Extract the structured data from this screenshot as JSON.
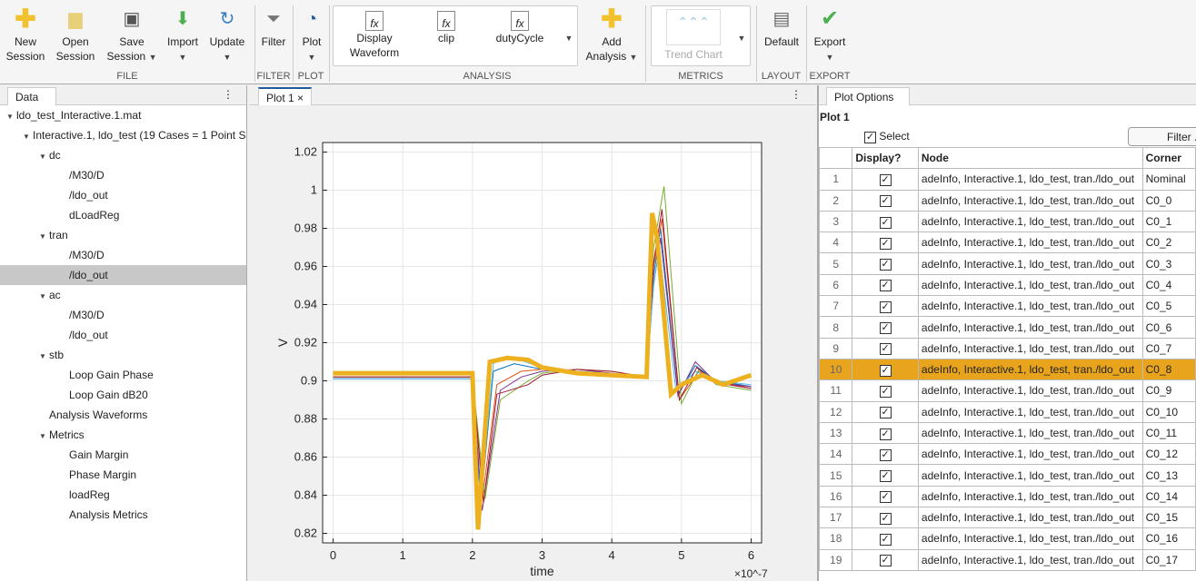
{
  "toolstrip": {
    "buttons": {
      "new_session": "New\nSession",
      "open_session": "Open\nSession",
      "save_session": "Save\nSession",
      "import": "Import",
      "update": "Update",
      "filter": "Filter",
      "plot": "Plot",
      "display_waveform": "Display\nWaveform",
      "clip": "clip",
      "duty_cycle": "dutyCycle",
      "add_analysis": "Add\nAnalysis",
      "trend_chart": "Trend Chart",
      "default": "Default",
      "export": "Export"
    },
    "sections": {
      "file": "FILE",
      "filter": "FILTER",
      "plot": "PLOT",
      "analysis": "ANALYSIS",
      "metrics": "METRICS",
      "layout": "LAYOUT",
      "export": "EXPORT"
    }
  },
  "data_panel": {
    "tab": "Data",
    "tree": [
      {
        "label": "ldo_test_Interactive.1.mat",
        "level": 0,
        "twisty": true
      },
      {
        "label": "Interactive.1, ldo_test  (19 Cases = 1 Point S",
        "level": 1,
        "twisty": true
      },
      {
        "label": "dc",
        "level": 2,
        "twisty": true
      },
      {
        "label": "/M30/D",
        "level": 3
      },
      {
        "label": "/ldo_out",
        "level": 3
      },
      {
        "label": "dLoadReg",
        "level": 3
      },
      {
        "label": "tran",
        "level": 2,
        "twisty": true
      },
      {
        "label": "/M30/D",
        "level": 3
      },
      {
        "label": "/ldo_out",
        "level": 3,
        "selected": true
      },
      {
        "label": "ac",
        "level": 2,
        "twisty": true
      },
      {
        "label": "/M30/D",
        "level": 3
      },
      {
        "label": "/ldo_out",
        "level": 3
      },
      {
        "label": "stb",
        "level": 2,
        "twisty": true
      },
      {
        "label": "Loop Gain Phase",
        "level": 3
      },
      {
        "label": "Loop Gain dB20",
        "level": 3
      },
      {
        "label": "Analysis Waveforms",
        "level": 2
      },
      {
        "label": "Metrics",
        "level": 2,
        "twisty": true
      },
      {
        "label": "Gain Margin",
        "level": 3
      },
      {
        "label": "Phase Margin",
        "level": 3
      },
      {
        "label": "loadReg",
        "level": 3
      },
      {
        "label": "Analysis Metrics",
        "level": 3
      }
    ]
  },
  "plot_panel": {
    "tab": "Plot 1"
  },
  "chart_data": {
    "type": "line",
    "xlabel": "time",
    "ylabel": "V",
    "x_exponent": "×10^-7",
    "xlim": [
      -0.15,
      6.15
    ],
    "ylim": [
      0.815,
      1.025
    ],
    "xticks": [
      0,
      1,
      2,
      3,
      4,
      5,
      6
    ],
    "yticks": [
      0.82,
      0.84,
      0.86,
      0.88,
      0.9,
      0.92,
      0.94,
      0.96,
      0.98,
      1,
      1.02
    ],
    "ytick_labels": [
      "0.82",
      "0.84",
      "0.86",
      "0.88",
      "0.9",
      "0.92",
      "0.94",
      "0.96",
      "0.98",
      "1",
      "1.02"
    ],
    "grid": true,
    "series": [
      {
        "name": "C0_0",
        "color": "#0072bd",
        "x": [
          0,
          2,
          2.12,
          2.3,
          2.6,
          3,
          3.5,
          4,
          4.5,
          4.6,
          4.7,
          4.95,
          5.2,
          5.5,
          6
        ],
        "y": [
          0.901,
          0.901,
          0.835,
          0.905,
          0.909,
          0.906,
          0.905,
          0.904,
          0.902,
          0.955,
          0.98,
          0.893,
          0.908,
          0.9,
          0.897
        ]
      },
      {
        "name": "C0_1",
        "color": "#d95319",
        "x": [
          0,
          2,
          2.15,
          2.35,
          2.7,
          3,
          3.5,
          4,
          4.5,
          4.6,
          4.72,
          4.97,
          5.25,
          5.5,
          6
        ],
        "y": [
          0.902,
          0.902,
          0.84,
          0.898,
          0.905,
          0.906,
          0.905,
          0.903,
          0.902,
          0.96,
          0.985,
          0.89,
          0.905,
          0.9,
          0.896
        ]
      },
      {
        "name": "C0_2",
        "color": "#7e2f8e",
        "x": [
          0,
          2,
          2.14,
          2.4,
          2.7,
          3,
          3.5,
          4,
          4.5,
          4.6,
          4.7,
          4.95,
          5.2,
          5.5,
          6
        ],
        "y": [
          0.901,
          0.901,
          0.832,
          0.895,
          0.902,
          0.905,
          0.906,
          0.904,
          0.902,
          0.95,
          0.975,
          0.892,
          0.91,
          0.899,
          0.897
        ]
      },
      {
        "name": "C0_3",
        "color": "#77ac30",
        "x": [
          0,
          2,
          2.18,
          2.4,
          2.8,
          3,
          3.5,
          4,
          4.5,
          4.6,
          4.75,
          5.0,
          5.25,
          5.5,
          6
        ],
        "y": [
          0.902,
          0.902,
          0.838,
          0.89,
          0.9,
          0.904,
          0.906,
          0.905,
          0.902,
          0.97,
          1.002,
          0.888,
          0.906,
          0.898,
          0.895
        ]
      },
      {
        "name": "C0_4",
        "color": "#4dbeee",
        "x": [
          0,
          2,
          2.1,
          2.3,
          2.5,
          3,
          3.5,
          4,
          4.5,
          4.6,
          4.68,
          4.92,
          5.2,
          5.5,
          6
        ],
        "y": [
          0.901,
          0.901,
          0.83,
          0.909,
          0.913,
          0.907,
          0.905,
          0.903,
          0.902,
          0.95,
          0.97,
          0.895,
          0.905,
          0.9,
          0.898
        ]
      },
      {
        "name": "C0_5",
        "color": "#a2142f",
        "x": [
          0,
          2,
          2.16,
          2.35,
          2.8,
          3,
          3.5,
          4,
          4.5,
          4.6,
          4.72,
          4.97,
          5.22,
          5.5,
          6
        ],
        "y": [
          0.902,
          0.902,
          0.836,
          0.893,
          0.898,
          0.903,
          0.906,
          0.905,
          0.902,
          0.962,
          0.99,
          0.89,
          0.907,
          0.899,
          0.896
        ]
      },
      {
        "name": "C0_8",
        "color": "#edb120",
        "highlight": true,
        "x": [
          0,
          2,
          2.08,
          2.25,
          2.5,
          2.8,
          3,
          3.5,
          4,
          4.5,
          4.58,
          4.65,
          4.85,
          5.0,
          5.3,
          5.6,
          6
        ],
        "y": [
          0.904,
          0.904,
          0.822,
          0.91,
          0.912,
          0.911,
          0.907,
          0.904,
          0.903,
          0.902,
          0.988,
          0.975,
          0.893,
          0.898,
          0.903,
          0.898,
          0.903
        ]
      }
    ]
  },
  "options_panel": {
    "tab": "Plot Options",
    "plot_title": "Plot 1",
    "select_label": "Select",
    "filter_button": "Filter ...",
    "columns": [
      "",
      "Display?",
      "Node",
      "Corner"
    ],
    "rows": [
      {
        "n": "1",
        "node": "adeInfo, Interactive.1, ldo_test, tran./ldo_out",
        "corner": "Nominal"
      },
      {
        "n": "2",
        "node": "adeInfo, Interactive.1, ldo_test, tran./ldo_out",
        "corner": "C0_0"
      },
      {
        "n": "3",
        "node": "adeInfo, Interactive.1, ldo_test, tran./ldo_out",
        "corner": "C0_1"
      },
      {
        "n": "4",
        "node": "adeInfo, Interactive.1, ldo_test, tran./ldo_out",
        "corner": "C0_2"
      },
      {
        "n": "5",
        "node": "adeInfo, Interactive.1, ldo_test, tran./ldo_out",
        "corner": "C0_3"
      },
      {
        "n": "6",
        "node": "adeInfo, Interactive.1, ldo_test, tran./ldo_out",
        "corner": "C0_4"
      },
      {
        "n": "7",
        "node": "adeInfo, Interactive.1, ldo_test, tran./ldo_out",
        "corner": "C0_5"
      },
      {
        "n": "8",
        "node": "adeInfo, Interactive.1, ldo_test, tran./ldo_out",
        "corner": "C0_6"
      },
      {
        "n": "9",
        "node": "adeInfo, Interactive.1, ldo_test, tran./ldo_out",
        "corner": "C0_7"
      },
      {
        "n": "10",
        "node": "adeInfo, Interactive.1, ldo_test, tran./ldo_out",
        "corner": "C0_8",
        "selected": true
      },
      {
        "n": "11",
        "node": "adeInfo, Interactive.1, ldo_test, tran./ldo_out",
        "corner": "C0_9"
      },
      {
        "n": "12",
        "node": "adeInfo, Interactive.1, ldo_test, tran./ldo_out",
        "corner": "C0_10"
      },
      {
        "n": "13",
        "node": "adeInfo, Interactive.1, ldo_test, tran./ldo_out",
        "corner": "C0_11"
      },
      {
        "n": "14",
        "node": "adeInfo, Interactive.1, ldo_test, tran./ldo_out",
        "corner": "C0_12"
      },
      {
        "n": "15",
        "node": "adeInfo, Interactive.1, ldo_test, tran./ldo_out",
        "corner": "C0_13"
      },
      {
        "n": "16",
        "node": "adeInfo, Interactive.1, ldo_test, tran./ldo_out",
        "corner": "C0_14"
      },
      {
        "n": "17",
        "node": "adeInfo, Interactive.1, ldo_test, tran./ldo_out",
        "corner": "C0_15"
      },
      {
        "n": "18",
        "node": "adeInfo, Interactive.1, ldo_test, tran./ldo_out",
        "corner": "C0_16"
      },
      {
        "n": "19",
        "node": "adeInfo, Interactive.1, ldo_test, tran./ldo_out",
        "corner": "C0_17"
      }
    ]
  }
}
